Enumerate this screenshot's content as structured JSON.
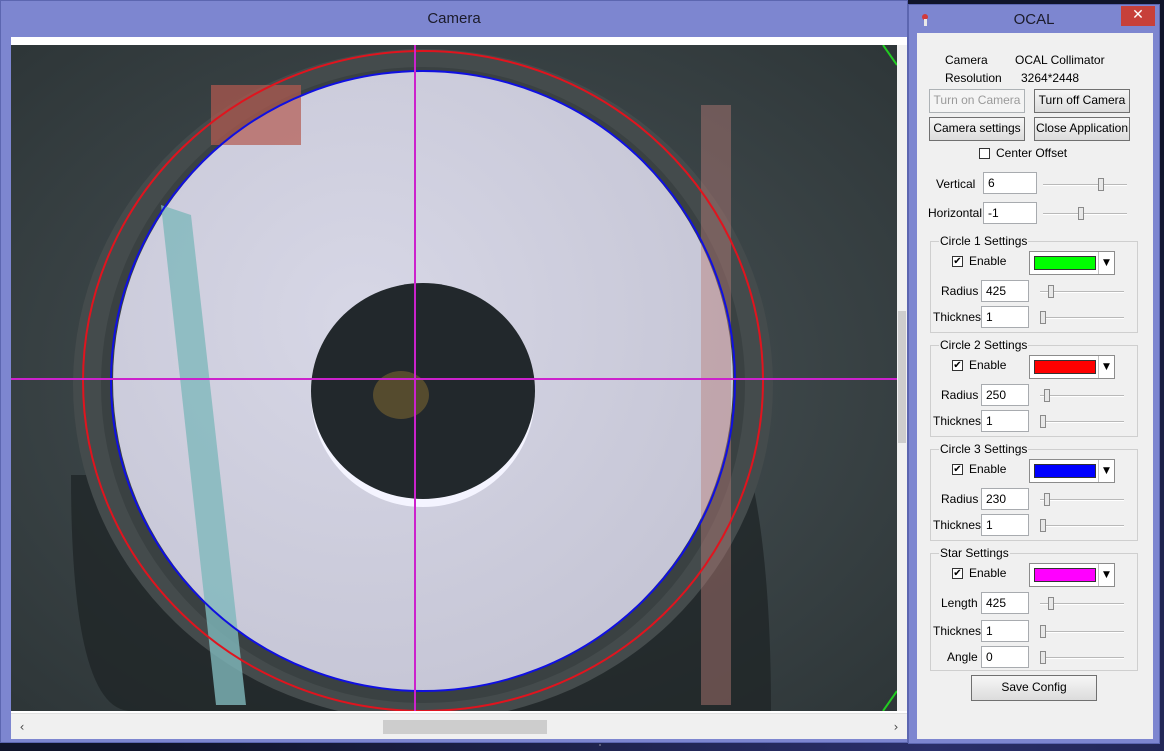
{
  "camera_window": {
    "title": "Camera"
  },
  "ocal_window": {
    "title": "OCAL",
    "close_glyph": "✕",
    "info": {
      "camera_label": "Camera",
      "camera_value": "OCAL Collimator",
      "resolution_label": "Resolution",
      "resolution_value": "3264*2448"
    },
    "buttons": {
      "turn_on": "Turn on Camera",
      "turn_off": "Turn off Camera",
      "camera_settings": "Camera settings",
      "close_app": "Close Application",
      "save_config": "Save Config"
    },
    "center_offset": {
      "label": "Center Offset",
      "checked": false,
      "vertical_label": "Vertical",
      "vertical_value": "6",
      "vertical_slider": 0.7,
      "horizontal_label": "Horizontal",
      "horizontal_value": "-1",
      "horizontal_slider": 0.45
    },
    "circle1": {
      "title": "Circle 1 Settings",
      "enable_label": "Enable",
      "enabled": true,
      "color": "#00ff00",
      "radius_label": "Radius",
      "radius": "425",
      "thickness_label": "Thickness",
      "thickness": "1"
    },
    "circle2": {
      "title": "Circle 2 Settings",
      "enable_label": "Enable",
      "enabled": true,
      "color": "#ff0000",
      "radius_label": "Radius",
      "radius": "250",
      "thickness_label": "Thickness",
      "thickness": "1"
    },
    "circle3": {
      "title": "Circle 3 Settings",
      "enable_label": "Enable",
      "enabled": true,
      "color": "#0000ff",
      "radius_label": "Radius",
      "radius": "230",
      "thickness_label": "Thickness",
      "thickness": "1"
    },
    "star": {
      "title": "Star Settings",
      "enable_label": "Enable",
      "enabled": true,
      "color": "#ff00ff",
      "length_label": "Length",
      "length": "425",
      "thickness_label": "Thickness",
      "thickness": "1",
      "angle_label": "Angle",
      "angle": "0"
    }
  },
  "overlay_colors": {
    "circle_red": "#e0141e",
    "circle_blue": "#1010e0",
    "crosshair": "#cc22cc"
  },
  "icons": {
    "scroll_left": "‹",
    "scroll_right": "›",
    "dropdown": "▼",
    "check": "✔"
  }
}
